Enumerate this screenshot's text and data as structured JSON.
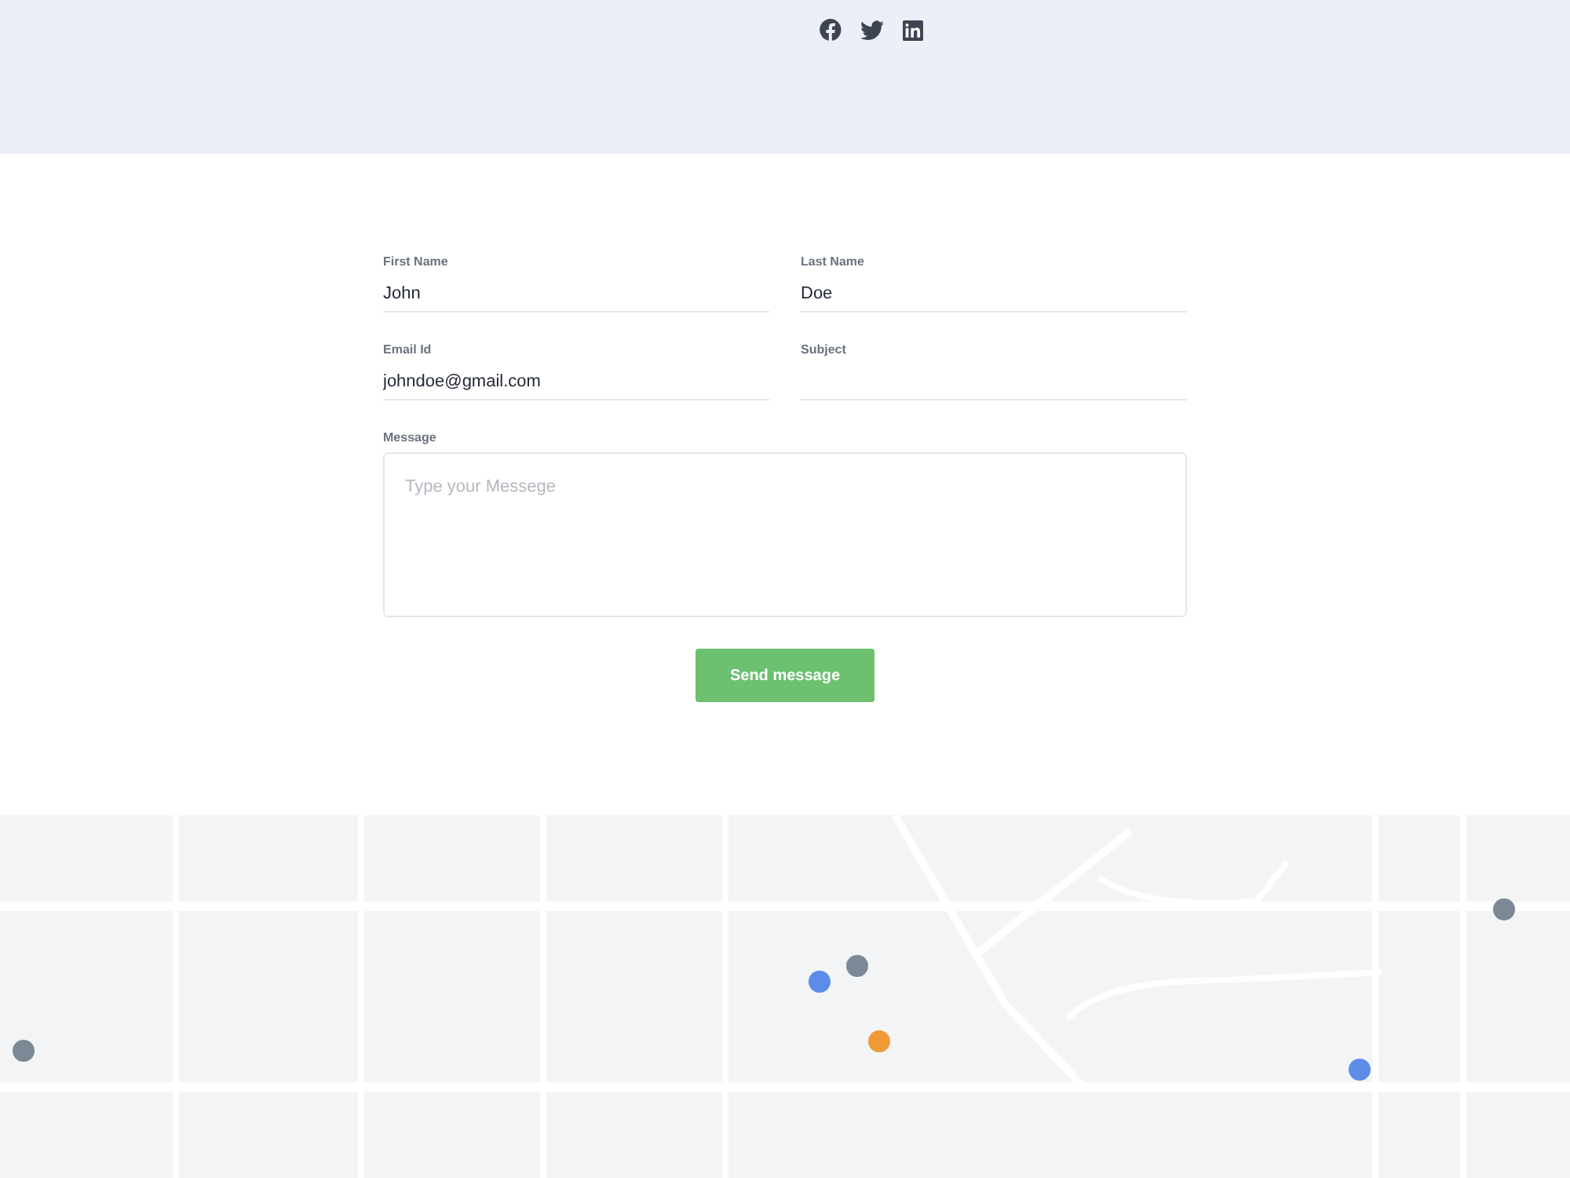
{
  "social_links": [
    {
      "kind": "facebook"
    },
    {
      "kind": "twitter"
    },
    {
      "kind": "linkedin"
    }
  ],
  "contact_form": {
    "fields": [
      {
        "label": "First Name",
        "value": "John"
      },
      {
        "label": "Last Name",
        "value": "Doe"
      },
      {
        "label": "Email Id",
        "value": "johndoe@gmail.com"
      },
      {
        "label": "Subject"
      }
    ],
    "message": {
      "label": "Message",
      "placeholder": "Type your Messege"
    },
    "submit_button": "Send message"
  }
}
